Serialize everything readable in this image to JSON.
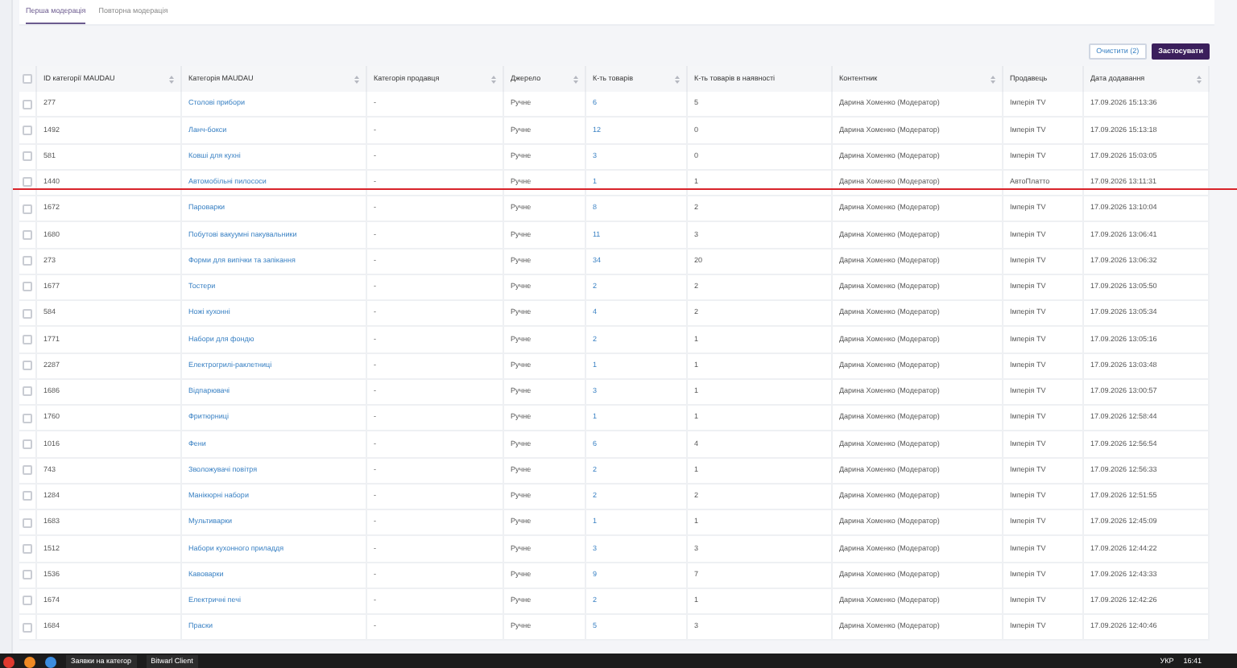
{
  "tabs": [
    {
      "label": "Перша модерація",
      "selected": true
    },
    {
      "label": "Повторна модерація",
      "selected": false
    }
  ],
  "buttons": [
    {
      "label": "Очистити (2)",
      "kind": "outline"
    },
    {
      "label": "Застосувати",
      "kind": "primary"
    }
  ],
  "table": {
    "select_all": {
      "checked": false
    },
    "columns": [
      {
        "label": "ID категорії MAUDAU",
        "sortable": true
      },
      {
        "label": "Категорія MAUDAU",
        "sortable": true
      },
      {
        "label": "Категорія продавця",
        "sortable": true
      },
      {
        "label": "Джерело",
        "sortable": true
      },
      {
        "label": "К-ть товарів",
        "sortable": true
      },
      {
        "label": "К-ть товарів в наявності",
        "sortable": false
      },
      {
        "label": "Контентник",
        "sortable": true
      },
      {
        "label": "Продавець",
        "sortable": false
      },
      {
        "label": "Дата додавання",
        "sortable": true
      }
    ],
    "rows": [
      {
        "checked": false,
        "cells": [
          "277",
          "Столові прибори",
          "-",
          "Ручне",
          "6",
          "5",
          "Дарина Хоменко (Модератор)",
          "Імперія TV",
          "17.09.2026 15:13:36"
        ]
      },
      {
        "checked": false,
        "cells": [
          "1492",
          "Ланч-бокси",
          "-",
          "Ручне",
          "12",
          "0",
          "Дарина Хоменко (Модератор)",
          "Імперія TV",
          "17.09.2026 15:13:18"
        ]
      },
      {
        "checked": false,
        "cells": [
          "581",
          "Ковші для кухні",
          "-",
          "Ручне",
          "3",
          "0",
          "Дарина Хоменко (Модератор)",
          "Імперія TV",
          "17.09.2026 15:03:05"
        ]
      },
      {
        "checked": false,
        "cells": [
          "1440",
          "Автомобільні пилососи",
          "-",
          "Ручне",
          "1",
          "1",
          "Дарина Хоменко (Модератор)",
          "АвтоПлатто",
          "17.09.2026 13:11:31"
        ]
      },
      {
        "checked": false,
        "cells": [
          "1672",
          "Пароварки",
          "-",
          "Ручне",
          "8",
          "2",
          "Дарина Хоменко (Модератор)",
          "Імперія TV",
          "17.09.2026 13:10:04"
        ]
      },
      {
        "checked": false,
        "cells": [
          "1680",
          "Побутові вакуумні пакувальники",
          "-",
          "Ручне",
          "11",
          "3",
          "Дарина Хоменко (Модератор)",
          "Імперія TV",
          "17.09.2026 13:06:41"
        ]
      },
      {
        "checked": false,
        "cells": [
          "273",
          "Форми для випічки та запікання",
          "-",
          "Ручне",
          "34",
          "20",
          "Дарина Хоменко (Модератор)",
          "Імперія TV",
          "17.09.2026 13:06:32"
        ]
      },
      {
        "checked": false,
        "cells": [
          "1677",
          "Тостери",
          "-",
          "Ручне",
          "2",
          "2",
          "Дарина Хоменко (Модератор)",
          "Імперія TV",
          "17.09.2026 13:05:50"
        ]
      },
      {
        "checked": false,
        "cells": [
          "584",
          "Ножі кухонні",
          "-",
          "Ручне",
          "4",
          "2",
          "Дарина Хоменко (Модератор)",
          "Імперія TV",
          "17.09.2026 13:05:34"
        ]
      },
      {
        "checked": false,
        "cells": [
          "1771",
          "Набори для фондю",
          "-",
          "Ручне",
          "2",
          "1",
          "Дарина Хоменко (Модератор)",
          "Імперія TV",
          "17.09.2026 13:05:16"
        ]
      },
      {
        "checked": false,
        "cells": [
          "2287",
          "Електрогрилі-раклетниці",
          "-",
          "Ручне",
          "1",
          "1",
          "Дарина Хоменко (Модератор)",
          "Імперія TV",
          "17.09.2026 13:03:48"
        ]
      },
      {
        "checked": false,
        "cells": [
          "1686",
          "Відпарювачі",
          "-",
          "Ручне",
          "3",
          "1",
          "Дарина Хоменко (Модератор)",
          "Імперія TV",
          "17.09.2026 13:00:57"
        ]
      },
      {
        "checked": false,
        "cells": [
          "1760",
          "Фритюрниці",
          "-",
          "Ручне",
          "1",
          "1",
          "Дарина Хоменко (Модератор)",
          "Імперія TV",
          "17.09.2026 12:58:44"
        ]
      },
      {
        "checked": false,
        "cells": [
          "1016",
          "Фени",
          "-",
          "Ручне",
          "6",
          "4",
          "Дарина Хоменко (Модератор)",
          "Імперія TV",
          "17.09.2026 12:56:54"
        ]
      },
      {
        "checked": false,
        "cells": [
          "743",
          "Зволожувачі повітря",
          "-",
          "Ручне",
          "2",
          "1",
          "Дарина Хоменко (Модератор)",
          "Імперія TV",
          "17.09.2026 12:56:33"
        ]
      },
      {
        "checked": false,
        "cells": [
          "1284",
          "Манікюрні набори",
          "-",
          "Ручне",
          "2",
          "2",
          "Дарина Хоменко (Модератор)",
          "Імперія TV",
          "17.09.2026 12:51:55"
        ]
      },
      {
        "checked": false,
        "cells": [
          "1683",
          "Мультиварки",
          "-",
          "Ручне",
          "1",
          "1",
          "Дарина Хоменко (Модератор)",
          "Імперія TV",
          "17.09.2026 12:45:09"
        ]
      },
      {
        "checked": false,
        "cells": [
          "1512",
          "Набори кухонного приладдя",
          "-",
          "Ручне",
          "3",
          "3",
          "Дарина Хоменко (Модератор)",
          "Імперія TV",
          "17.09.2026 12:44:22"
        ]
      },
      {
        "checked": false,
        "cells": [
          "1536",
          "Кавоварки",
          "-",
          "Ручне",
          "9",
          "7",
          "Дарина Хоменко (Модератор)",
          "Імперія TV",
          "17.09.2026 12:43:33"
        ]
      },
      {
        "checked": false,
        "cells": [
          "1674",
          "Електричні печі",
          "-",
          "Ручне",
          "2",
          "1",
          "Дарина Хоменко (Модератор)",
          "Імперія TV",
          "17.09.2026 12:42:26"
        ]
      },
      {
        "checked": false,
        "cells": [
          "1684",
          "Праски",
          "-",
          "Ручне",
          "5",
          "3",
          "Дарина Хоменко (Модератор)",
          "Імперія TV",
          "17.09.2026 12:40:46"
        ]
      }
    ]
  },
  "taskbar": {
    "apps": [
      {
        "label": "Заявки на категор"
      },
      {
        "label": "Bitwarl Client"
      }
    ],
    "language": "УКР",
    "time": "16:41"
  }
}
